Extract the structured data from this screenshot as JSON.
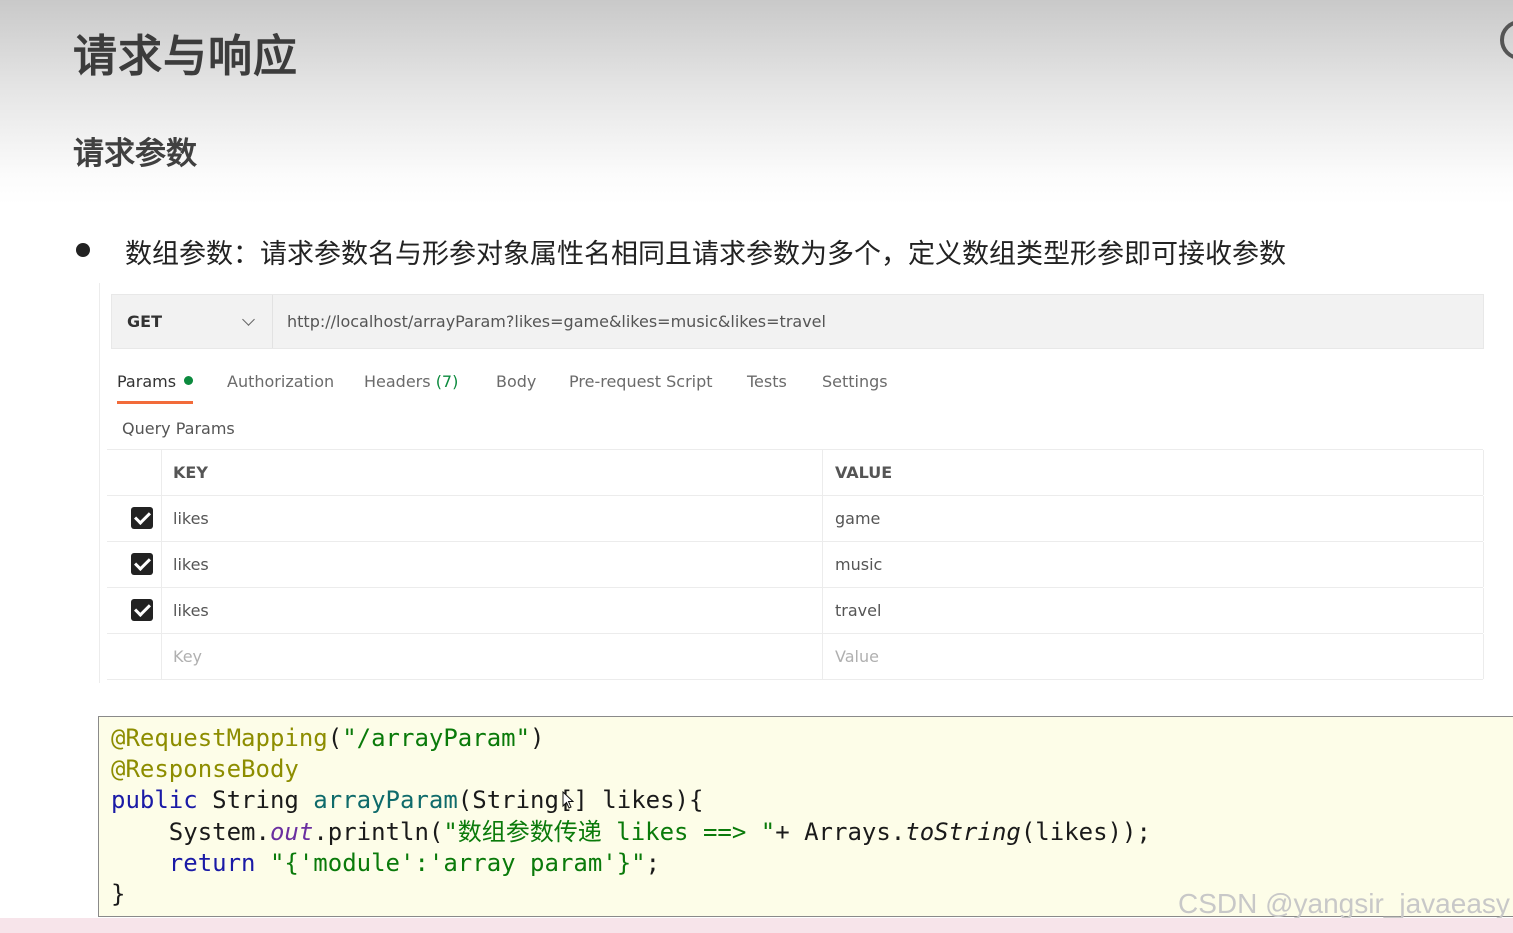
{
  "slide": {
    "title": "请求与响应",
    "subtitle": "请求参数",
    "bullet": "数组参数：请求参数名与形参对象属性名相同且请求参数为多个，定义数组类型形参即可接收参数"
  },
  "request": {
    "method": "GET",
    "url": "http://localhost/arrayParam?likes=game&likes=music&likes=travel"
  },
  "tabs": [
    {
      "label": "Params",
      "active": true
    },
    {
      "label": "Authorization"
    },
    {
      "label": "Headers",
      "count": "(7)"
    },
    {
      "label": "Body"
    },
    {
      "label": "Pre-request Script"
    },
    {
      "label": "Tests"
    },
    {
      "label": "Settings"
    }
  ],
  "query_params": {
    "label": "Query Params",
    "headers": {
      "key": "KEY",
      "value": "VALUE"
    },
    "rows": [
      {
        "checked": true,
        "key": "likes",
        "value": "game"
      },
      {
        "checked": true,
        "key": "likes",
        "value": "music"
      },
      {
        "checked": true,
        "key": "likes",
        "value": "travel"
      }
    ],
    "placeholder": {
      "key": "Key",
      "value": "Value"
    }
  },
  "code": {
    "line1_annotation": "@RequestMapping",
    "line1_paren_open": "(",
    "line1_string": "\"/arrayParam\"",
    "line1_paren_close": ")",
    "line2_annotation": "@ResponseBody",
    "line3_kw": "public",
    "line3_type": " String ",
    "line3_method": "arrayParam",
    "line3_rest": "(String[] likes){",
    "line4_indent": "    System.",
    "line4_out": "out",
    "line4_mid": ".println(",
    "line4_string": "\"数组参数传递 likes ==> \"",
    "line4_rest": "+ Arrays.",
    "line4_tostring": "toString",
    "line4_end": "(likes));",
    "line5_indent": "    ",
    "line5_kw": "return",
    "line5_sp": " ",
    "line5_string": "\"{'module':'array param'}\"",
    "line5_end": ";",
    "line6": "}"
  },
  "watermark": "CSDN @yangsir_javaeasy"
}
